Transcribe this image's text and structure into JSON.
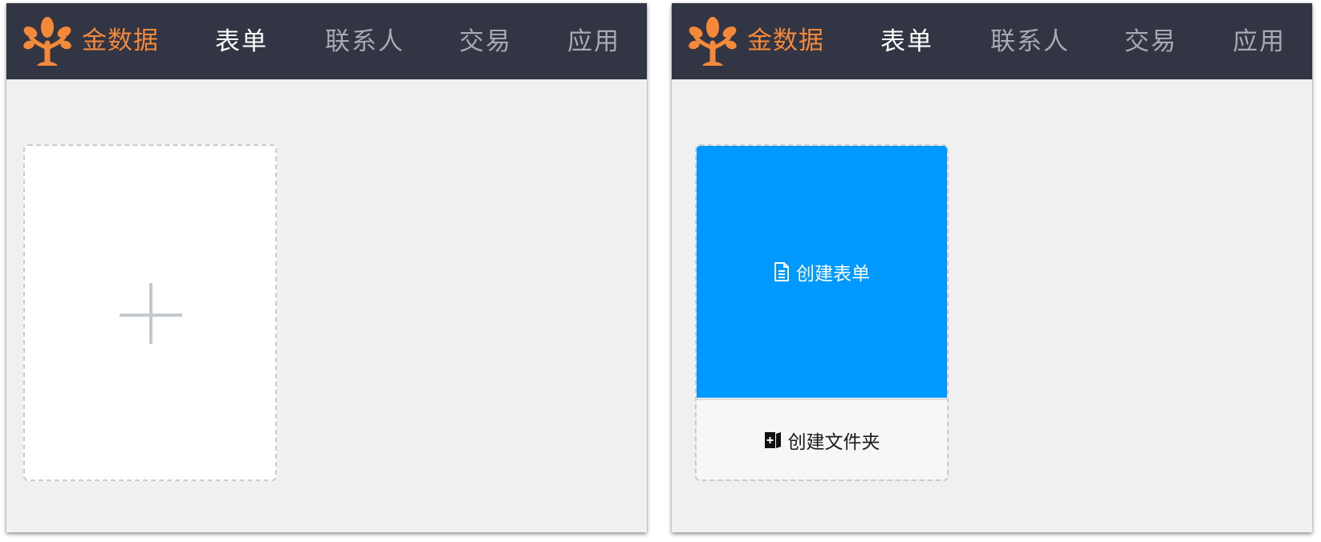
{
  "brand": {
    "name": "金数据",
    "color": "#f5893a"
  },
  "nav": {
    "items": [
      "表单",
      "联系人",
      "交易",
      "应用"
    ],
    "active_index": 0
  },
  "left_panel": {
    "add_card_icon": "plus-icon"
  },
  "right_panel": {
    "create_form_label": "创建表单",
    "create_form_icon": "document-icon",
    "create_folder_label": "创建文件夹",
    "create_folder_icon": "folder-add-icon",
    "accent_color": "#0099ff"
  }
}
